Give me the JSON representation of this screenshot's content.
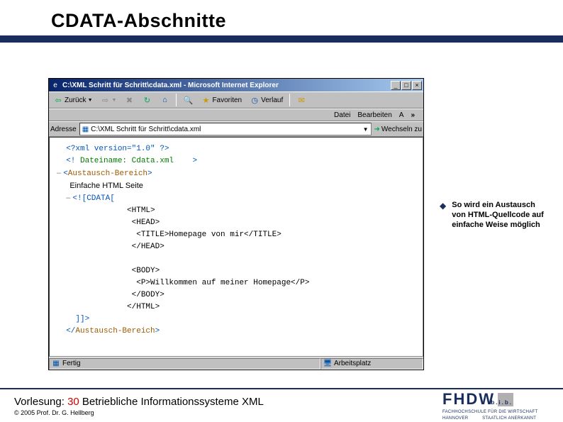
{
  "slide": {
    "title": "CDATA-Abschnitte"
  },
  "browser": {
    "window_title": "C:\\XML Schritt für Schritt\\cdata.xml - Microsoft Internet Explorer",
    "menu": {
      "datei": "Datei",
      "bearbeiten": "Bearbeiten",
      "ansicht": "A",
      "chevron": "»"
    },
    "toolbar": {
      "back": "Zurück",
      "favorites": "Favoriten",
      "history": "Verlauf"
    },
    "address": {
      "label": "Adresse",
      "value": "C:\\XML Schritt für Schritt\\cdata.xml",
      "go": "Wechseln zu"
    },
    "xml": {
      "l1_a": "<?xml version=\"1.0\" ?>",
      "l2_a": "<!",
      "l2_b": " Dateiname: Cdata.xml ",
      "l2_c": ">",
      "l3_a": "<",
      "l3_b": "Austausch-Bereich",
      "l3_c": ">",
      "l4_a": "Einfache HTML Seite",
      "l5_a": "<![CDATA[",
      "l6_a": "<HTML>",
      "l7_a": "<HEAD>",
      "l8_a": "<TITLE>Homepage von mir</TITLE>",
      "l9_a": "</HEAD>",
      "l10_a": "<BODY>",
      "l11_a": "<P>Willkommen auf meiner Homepage</P>",
      "l12_a": "</BODY>",
      "l13_a": "</HTML>",
      "l14_a": "]]>",
      "l15_a": "</",
      "l15_b": "Austausch-Bereich",
      "l15_c": ">"
    },
    "status": {
      "done": "Fertig",
      "zone": "Arbeitsplatz"
    }
  },
  "bullet": {
    "text": "So wird ein Austausch von HTML-Quellcode auf einfache Weise möglich"
  },
  "footer": {
    "lecture_label": "Vorlesung:",
    "lecture_num": "30",
    "lecture_title": "Betriebliche Informationssysteme XML",
    "copyright": "© 2005 Prof. Dr. G. Hellberg",
    "logo_text": "FHDW",
    "logo_sub1": "FACHHOCHSCHULE FÜR DIE WIRTSCHAFT",
    "logo_sub2": "HANNOVER",
    "logo_sub3": "STAATLICH ANERKANNT"
  }
}
